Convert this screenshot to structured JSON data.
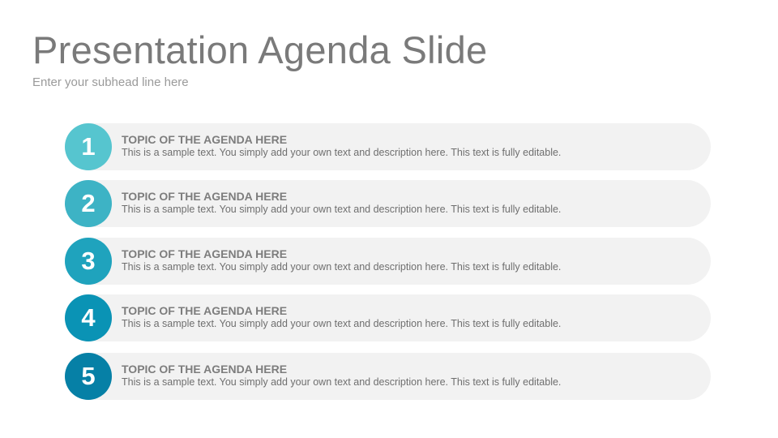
{
  "slide": {
    "title": "Presentation Agenda Slide",
    "subhead": "Enter your subhead line here"
  },
  "agenda": {
    "items": [
      {
        "number": "1",
        "title": "TOPIC OF THE AGENDA HERE",
        "description": "This is a sample text. You simply add your own text and description here. This text is fully editable.",
        "color": "#56c5cf"
      },
      {
        "number": "2",
        "title": "TOPIC OF THE AGENDA HERE",
        "description": "This is a sample text. You simply add your own text and description here. This text is fully editable.",
        "color": "#3db3c5"
      },
      {
        "number": "3",
        "title": "TOPIC OF THE AGENDA HERE",
        "description": "This is a sample text. You simply add your own text and description here. This text is fully editable.",
        "color": "#1fa3bd"
      },
      {
        "number": "4",
        "title": "TOPIC OF THE AGENDA HERE",
        "description": "This is a sample text. You simply add your own text and description here. This text is fully editable.",
        "color": "#0a93b5"
      },
      {
        "number": "5",
        "title": "TOPIC OF THE AGENDA HERE",
        "description": "This is a sample text. You simply add your own text and description here. This text is fully editable.",
        "color": "#0680a6"
      }
    ]
  }
}
